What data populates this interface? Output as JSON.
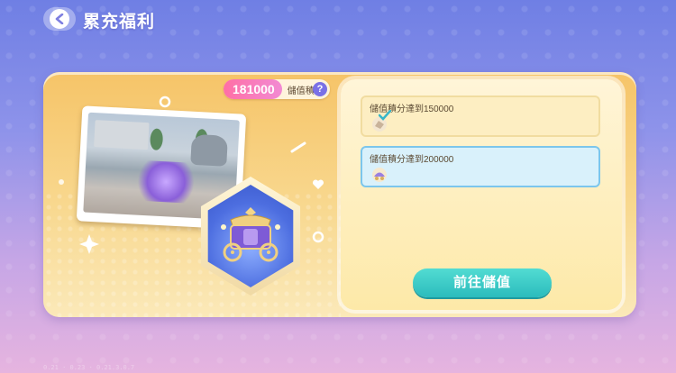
{
  "header": {
    "title": "累充福利"
  },
  "points": {
    "value": "181000",
    "label": "儲值積分",
    "help": "?"
  },
  "tasks": [
    {
      "label": "儲值積分達到150000",
      "completed": true
    },
    {
      "label": "儲值積分達到200000",
      "completed": false
    }
  ],
  "actions": {
    "go_label": "前往儲值"
  },
  "footer": {
    "text": "0.21 · 0.23 · 0.21.3.0.7"
  },
  "colors": {
    "accent_teal": "#2bbcbd",
    "points_pink": "#ff6fa5",
    "card_gold": "#f6c468"
  }
}
